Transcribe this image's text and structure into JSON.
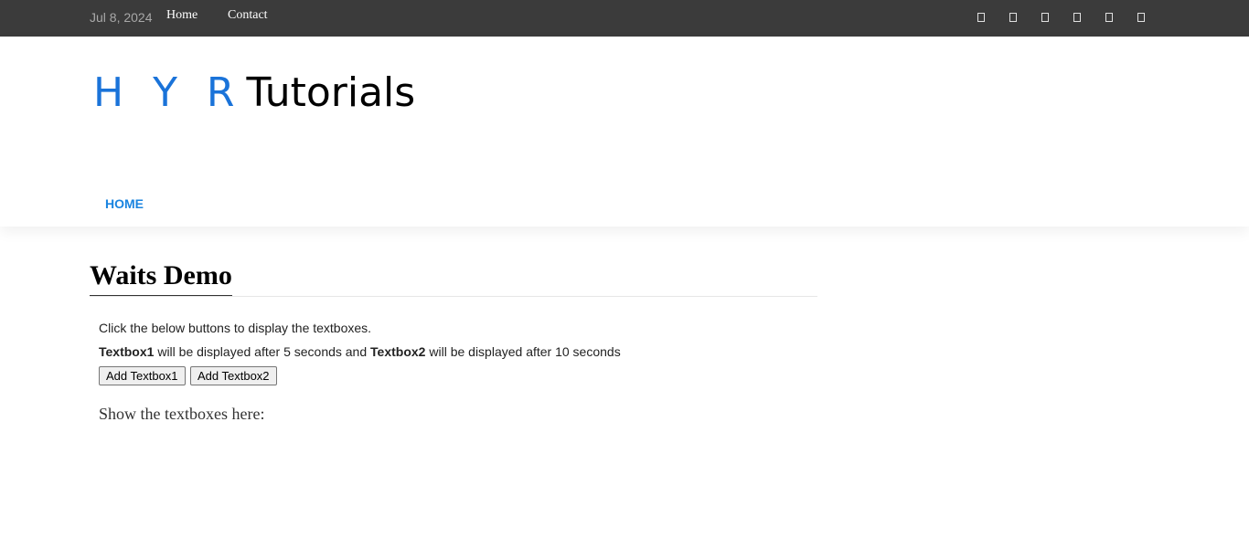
{
  "topbar": {
    "date": "Jul 8, 2024",
    "links": [
      "Home",
      "Contact"
    ],
    "social_icons": [
      "social-icon-1",
      "social-icon-2",
      "social-icon-3",
      "social-icon-4",
      "social-icon-5",
      "social-icon-6"
    ]
  },
  "header": {
    "logo_part1": "H Y R",
    "logo_part2": "Tutorials",
    "nav_home": "HOME"
  },
  "main": {
    "title": "Waits Demo",
    "instruction": "Click the below buttons to display the textboxes.",
    "detail_tb1": "Textbox1",
    "detail_mid": " will be displayed after 5 seconds and ",
    "detail_tb2": "Textbox2",
    "detail_end": " will be displayed after 10 seconds",
    "button1": "Add Textbox1",
    "button2": "Add Textbox2",
    "show_label": "Show the textboxes here:"
  },
  "colors": {
    "topbar_bg": "#3b3b3b",
    "logo_accent": "#1a73d9",
    "nav_accent": "#1a84e0"
  }
}
